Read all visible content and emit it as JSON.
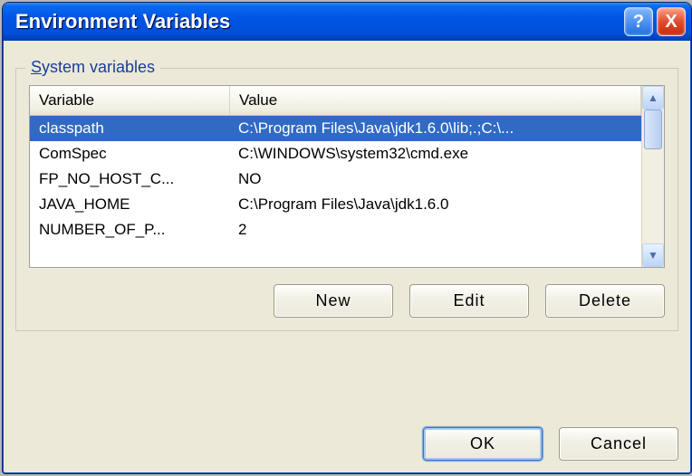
{
  "title": "Environment Variables",
  "group_label_prefix": "S",
  "group_label_rest": "ystem variables",
  "columns": {
    "variable": "Variable",
    "value": "Value"
  },
  "rows": [
    {
      "name": "classpath",
      "value": "C:\\Program Files\\Java\\jdk1.6.0\\lib;.;C:\\..."
    },
    {
      "name": "ComSpec",
      "value": "C:\\WINDOWS\\system32\\cmd.exe"
    },
    {
      "name": "FP_NO_HOST_C...",
      "value": "NO"
    },
    {
      "name": "JAVA_HOME",
      "value": "C:\\Program Files\\Java\\jdk1.6.0"
    },
    {
      "name": "NUMBER_OF_P...",
      "value": "2"
    }
  ],
  "buttons": {
    "new": "New",
    "edit": "Edit",
    "delete": "Delete",
    "ok": "OK",
    "cancel": "Cancel"
  },
  "titlebar": {
    "help": "?",
    "close": "X"
  },
  "scroll": {
    "up": "▲",
    "down": "▼"
  }
}
